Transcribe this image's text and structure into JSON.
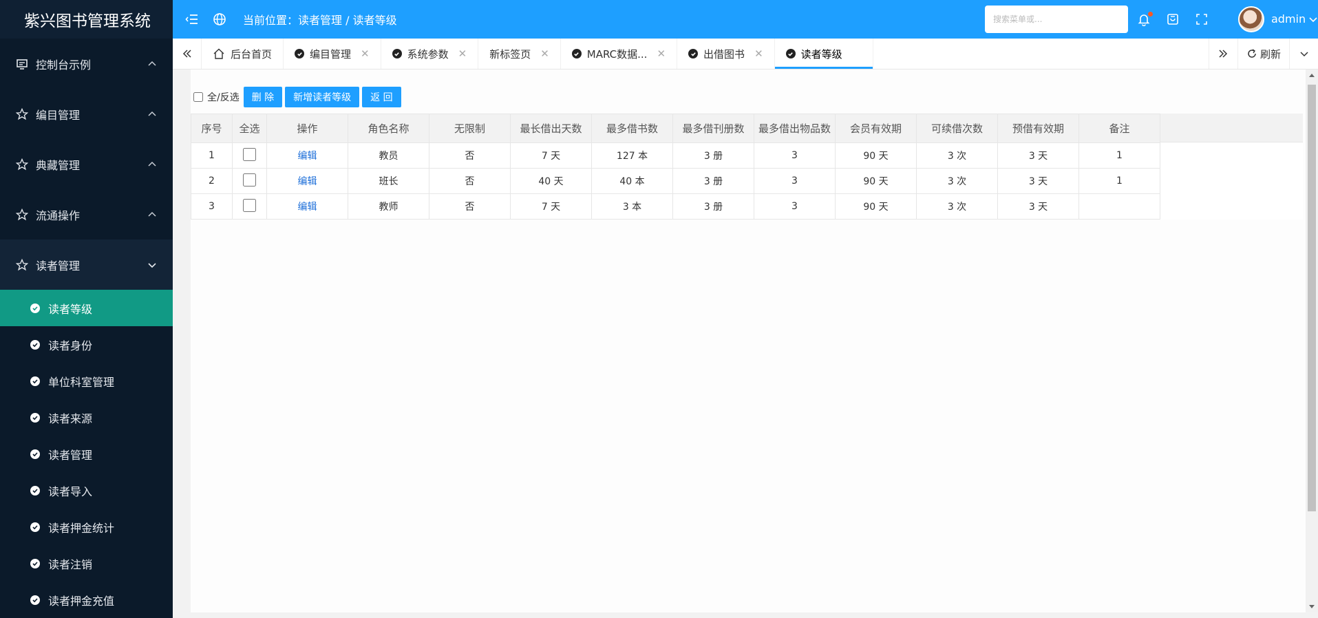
{
  "app": {
    "title": "紫兴图书管理系统"
  },
  "sidebar": {
    "groups": [
      {
        "label": "控制台示例",
        "icon": "monitor-icon"
      },
      {
        "label": "编目管理",
        "icon": "star-icon"
      },
      {
        "label": "典藏管理",
        "icon": "star-icon"
      },
      {
        "label": "流通操作",
        "icon": "star-icon"
      },
      {
        "label": "读者管理",
        "icon": "star-icon"
      }
    ],
    "sub_items": [
      {
        "label": "读者等级"
      },
      {
        "label": "读者身份"
      },
      {
        "label": "单位科室管理"
      },
      {
        "label": "读者来源"
      },
      {
        "label": "读者管理"
      },
      {
        "label": "读者导入"
      },
      {
        "label": "读者押金统计"
      },
      {
        "label": "读者注销"
      },
      {
        "label": "读者押金充值"
      }
    ]
  },
  "header": {
    "breadcrumb": "当前位置：读者管理 / 读者等级",
    "search_placeholder": "搜索菜单或...",
    "username": "admin",
    "colors": {
      "primary": "#1e9fff",
      "active_menu": "#119a85",
      "sidebar_bg": "#0b1a2a",
      "notify_dot": "#ff5722"
    }
  },
  "tabs": [
    {
      "label": "后台首页"
    },
    {
      "label": "编目管理"
    },
    {
      "label": "系统参数"
    },
    {
      "label": "新标签页"
    },
    {
      "label": "MARC数据..."
    },
    {
      "label": "出借图书"
    },
    {
      "label": "读者等级"
    }
  ],
  "tabbar": {
    "refresh": "刷新"
  },
  "toolbar": {
    "select_all": "全/反选",
    "delete": "删 除",
    "add": "新增读者等级",
    "back": "返 回"
  },
  "table": {
    "headers": [
      "序号",
      "全选",
      "操作",
      "角色名称",
      "无限制",
      "最长借出天数",
      "最多借书数",
      "最多借刊册数",
      "最多借出物品数",
      "会员有效期",
      "可续借次数",
      "预借有效期",
      "备注"
    ],
    "rows": [
      {
        "no": "1",
        "action": "编辑",
        "role": "教员",
        "unlimited": "否",
        "max_days": "7 天",
        "max_books": "127 本",
        "max_journals": "3 册",
        "max_items": "3",
        "valid": "90 天",
        "renew": "3 次",
        "reserve": "3 天",
        "note": "1"
      },
      {
        "no": "2",
        "action": "编辑",
        "role": "班长",
        "unlimited": "否",
        "max_days": "40 天",
        "max_books": "40 本",
        "max_journals": "3 册",
        "max_items": "3",
        "valid": "90 天",
        "renew": "3 次",
        "reserve": "3 天",
        "note": "1"
      },
      {
        "no": "3",
        "action": "编辑",
        "role": "教师",
        "unlimited": "否",
        "max_days": "7 天",
        "max_books": "3 本",
        "max_journals": "3 册",
        "max_items": "3",
        "valid": "90 天",
        "renew": "3 次",
        "reserve": "3 天",
        "note": ""
      }
    ]
  }
}
